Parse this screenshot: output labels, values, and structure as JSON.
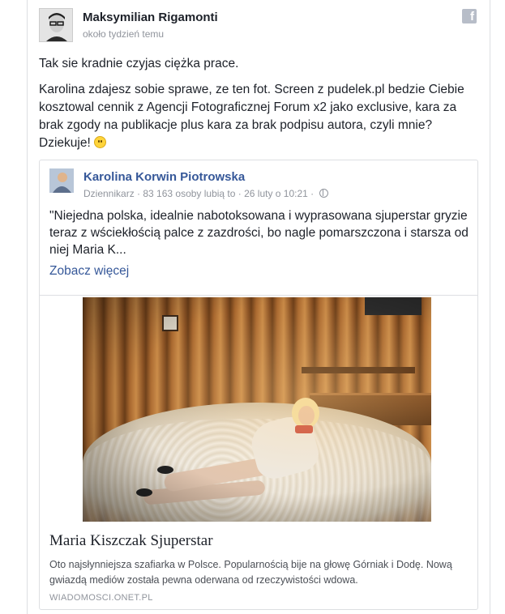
{
  "post": {
    "author": "Maksymilian Rigamonti",
    "time": "około tydzień temu",
    "paragraph1": "Tak sie kradnie czyjas ciężka prace.",
    "paragraph2": "Karolina zdajesz sobie sprawe, ze ten fot. Screen z pudelek.pl bedzie Ciebie kosztowal cennik z Agencji Fotograficznej Forum x2 jako exclusive, kara za brak zgody na publikacje plus kara za brak podpisu autora, czyli mnie? Dziekuje!",
    "emoji": "smile-emoji",
    "brand_icon": "facebook-icon"
  },
  "shared": {
    "author": "Karolina Korwin Piotrowska",
    "meta": "Dziennikarz · 83 163 osoby lubią to · 26 luty o 10:21 ·",
    "privacy_icon": "globe-icon",
    "text": "\"Niejedna polska, idealnie nabotoksowana i wyprasowana sjuperstar gryzie teraz z wściekłością palce z zazdrości, bo nagle pomarszczona i starsza od niej Maria K...",
    "see_more": "Zobacz więcej"
  },
  "link_card": {
    "title": "Maria Kiszczak Sjuperstar",
    "description": "Oto najsłynniejsza szafiarka w Polsce. Popularnością bije na głowę Górniak i Dodę. Nową gwiazdą mediów została pewna oderwana od rzeczywistości wdowa.",
    "domain": "WIADOMOSCI.ONET.PL"
  },
  "colors": {
    "link_blue": "#365899",
    "meta_gray": "#90949c",
    "text_dark": "#1d2129",
    "border": "#dddfe2"
  }
}
